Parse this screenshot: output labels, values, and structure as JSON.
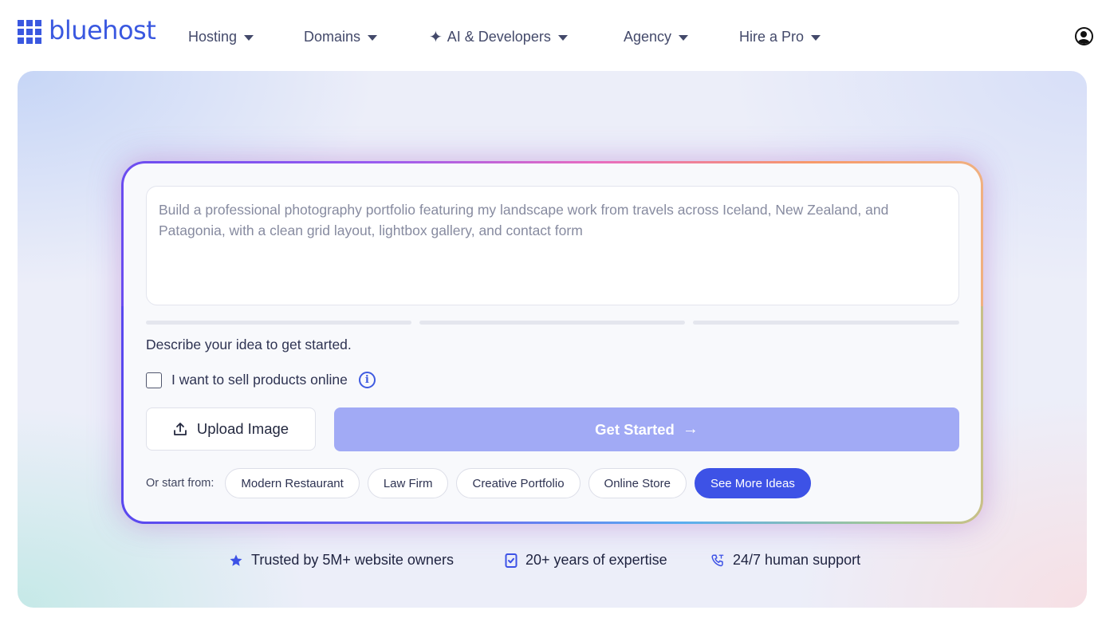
{
  "brand": {
    "name": "bluehost",
    "color": "#3a58e0"
  },
  "nav": {
    "items": [
      {
        "label": "Hosting"
      },
      {
        "label": "Domains"
      },
      {
        "label": "AI & Developers"
      },
      {
        "label": "Agency"
      },
      {
        "label": "Hire a Pro"
      }
    ],
    "account_icon": "user-circle-icon"
  },
  "builder": {
    "prompt_text": "Build a professional photography portfolio featuring my landscape work from travels across Iceland, New Zealand, and Patagonia, with a clean grid layout, lightbox gallery, and contact form",
    "helper_text": "Describe your idea to get started.",
    "sell_products_label": "I want to sell products online",
    "sell_products_checked": false,
    "upload_label": "Upload Image",
    "get_started_label": "Get Started",
    "ideas_label": "Or start from:",
    "ideas": [
      "Modern Restaurant",
      "Law Firm",
      "Creative Portfolio",
      "Online Store"
    ],
    "see_more_label": "See More Ideas",
    "accent_color": "#3d52e6",
    "button_color": "#a1aaf5"
  },
  "trust": {
    "items": [
      {
        "label": "Trusted by 5M+ website owners",
        "icon": "star-icon"
      },
      {
        "label": "20+ years of expertise",
        "icon": "badge-check-icon"
      },
      {
        "label": "24/7 human support",
        "icon": "phone-icon"
      }
    ]
  }
}
